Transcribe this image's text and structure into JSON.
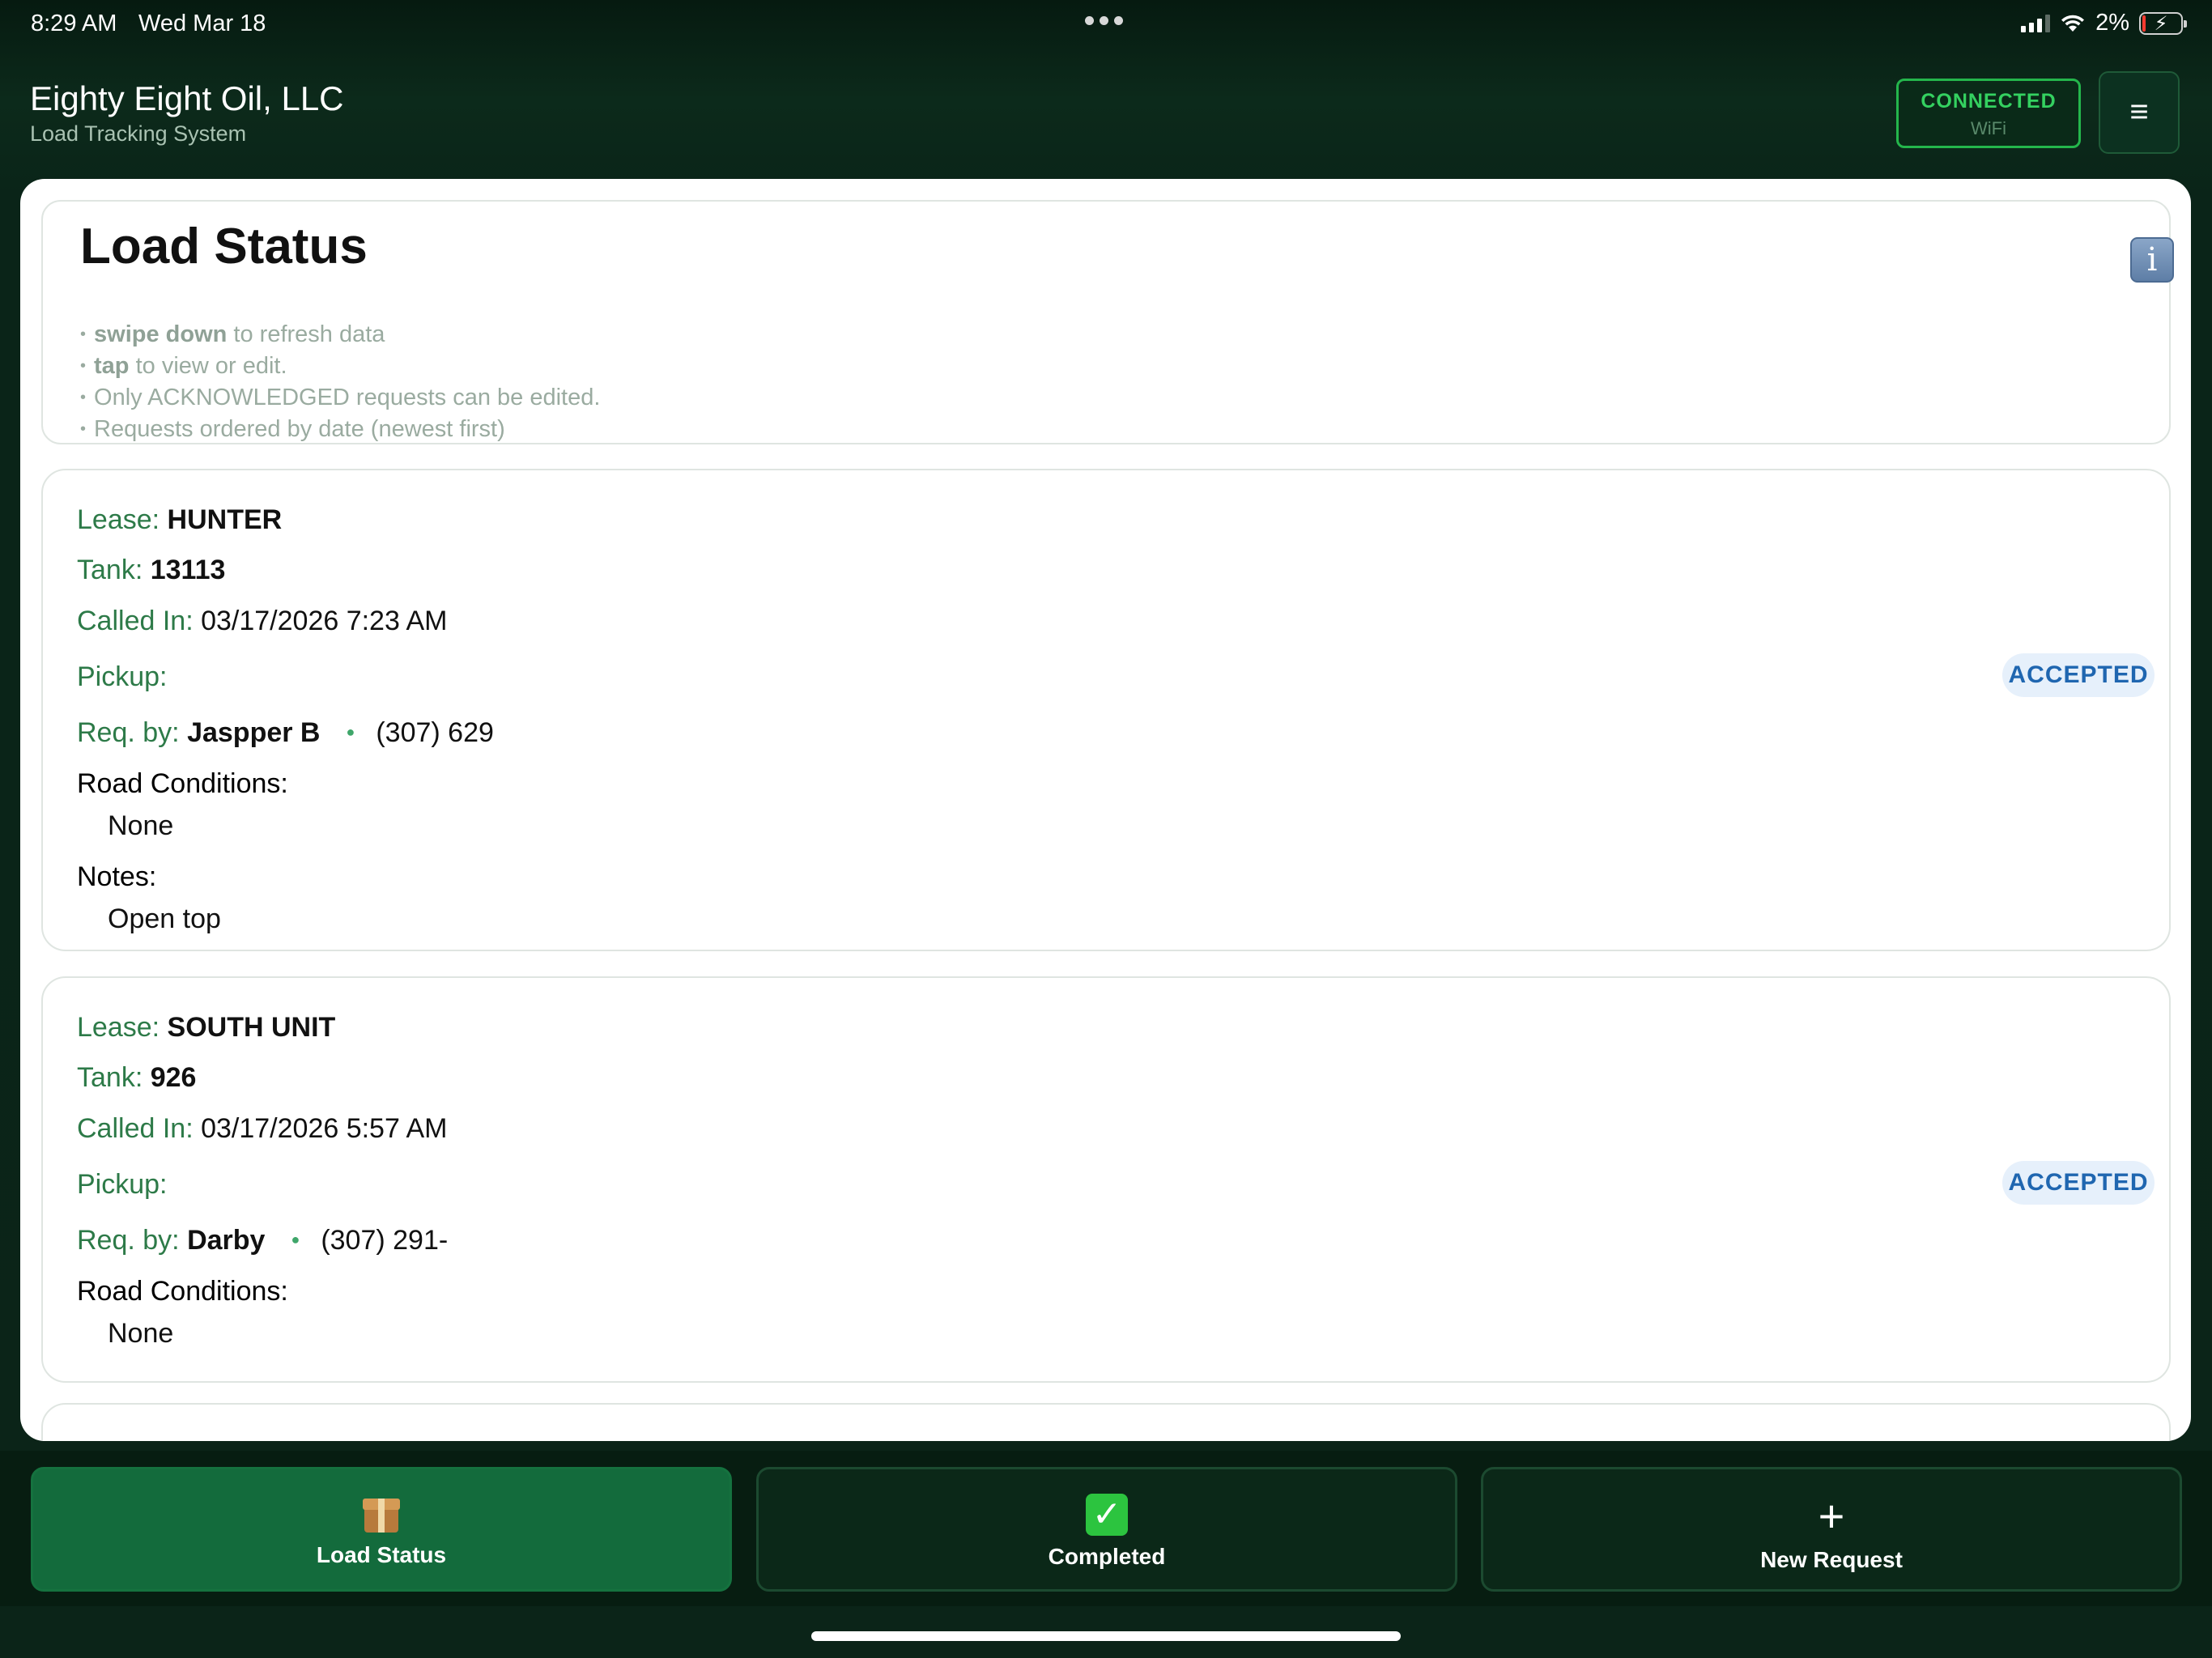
{
  "status_bar": {
    "time": "8:29 AM",
    "date": "Wed Mar 18",
    "battery": "2%"
  },
  "header": {
    "title": "Eighty Eight Oil, LLC",
    "subtitle": "Load Tracking System",
    "connection": {
      "status": "CONNECTED",
      "type": "WiFi"
    },
    "menu_icon": "hamburger-icon"
  },
  "info": {
    "title": "Load Status",
    "tips": [
      {
        "bold": "swipe down",
        "text": " to refresh data"
      },
      {
        "bold": "tap",
        "text": " to view or edit."
      },
      {
        "bold": "",
        "text": "Only ACKNOWLEDGED requests can be edited."
      },
      {
        "bold": "",
        "text": "Requests ordered by date (newest first)"
      }
    ]
  },
  "labels": {
    "lease": "Lease:",
    "tank": "Tank:",
    "called_in": "Called In:",
    "pickup": "Pickup:",
    "req_by": "Req. by:",
    "road_conditions": "Road Conditions:",
    "notes": "Notes:"
  },
  "loads": [
    {
      "lease": "HUNTER",
      "tank": "13113",
      "called_in": "03/17/2026 7:23 AM",
      "pickup": "",
      "requested_by": "Jaspper B",
      "phone": "(307) 629",
      "road_conditions": "None",
      "notes": "Open top",
      "status": "ACCEPTED"
    },
    {
      "lease": "SOUTH UNIT",
      "tank": "926",
      "called_in": "03/17/2026 5:57 AM",
      "pickup": "",
      "requested_by": "Darby",
      "phone": "(307) 291-",
      "road_conditions": "None",
      "status": "ACCEPTED"
    }
  ],
  "tabs": [
    {
      "label": "Load Status",
      "icon": "package-icon",
      "active": true
    },
    {
      "label": "Completed",
      "icon": "checkmark-icon",
      "active": false
    },
    {
      "label": "New Request",
      "icon": "plus-icon",
      "active": false
    }
  ],
  "colors": {
    "accent_green": "#136b3c",
    "connected_green": "#34d160",
    "label_green": "#2d7a48",
    "status_blue": "#1f66b0"
  }
}
